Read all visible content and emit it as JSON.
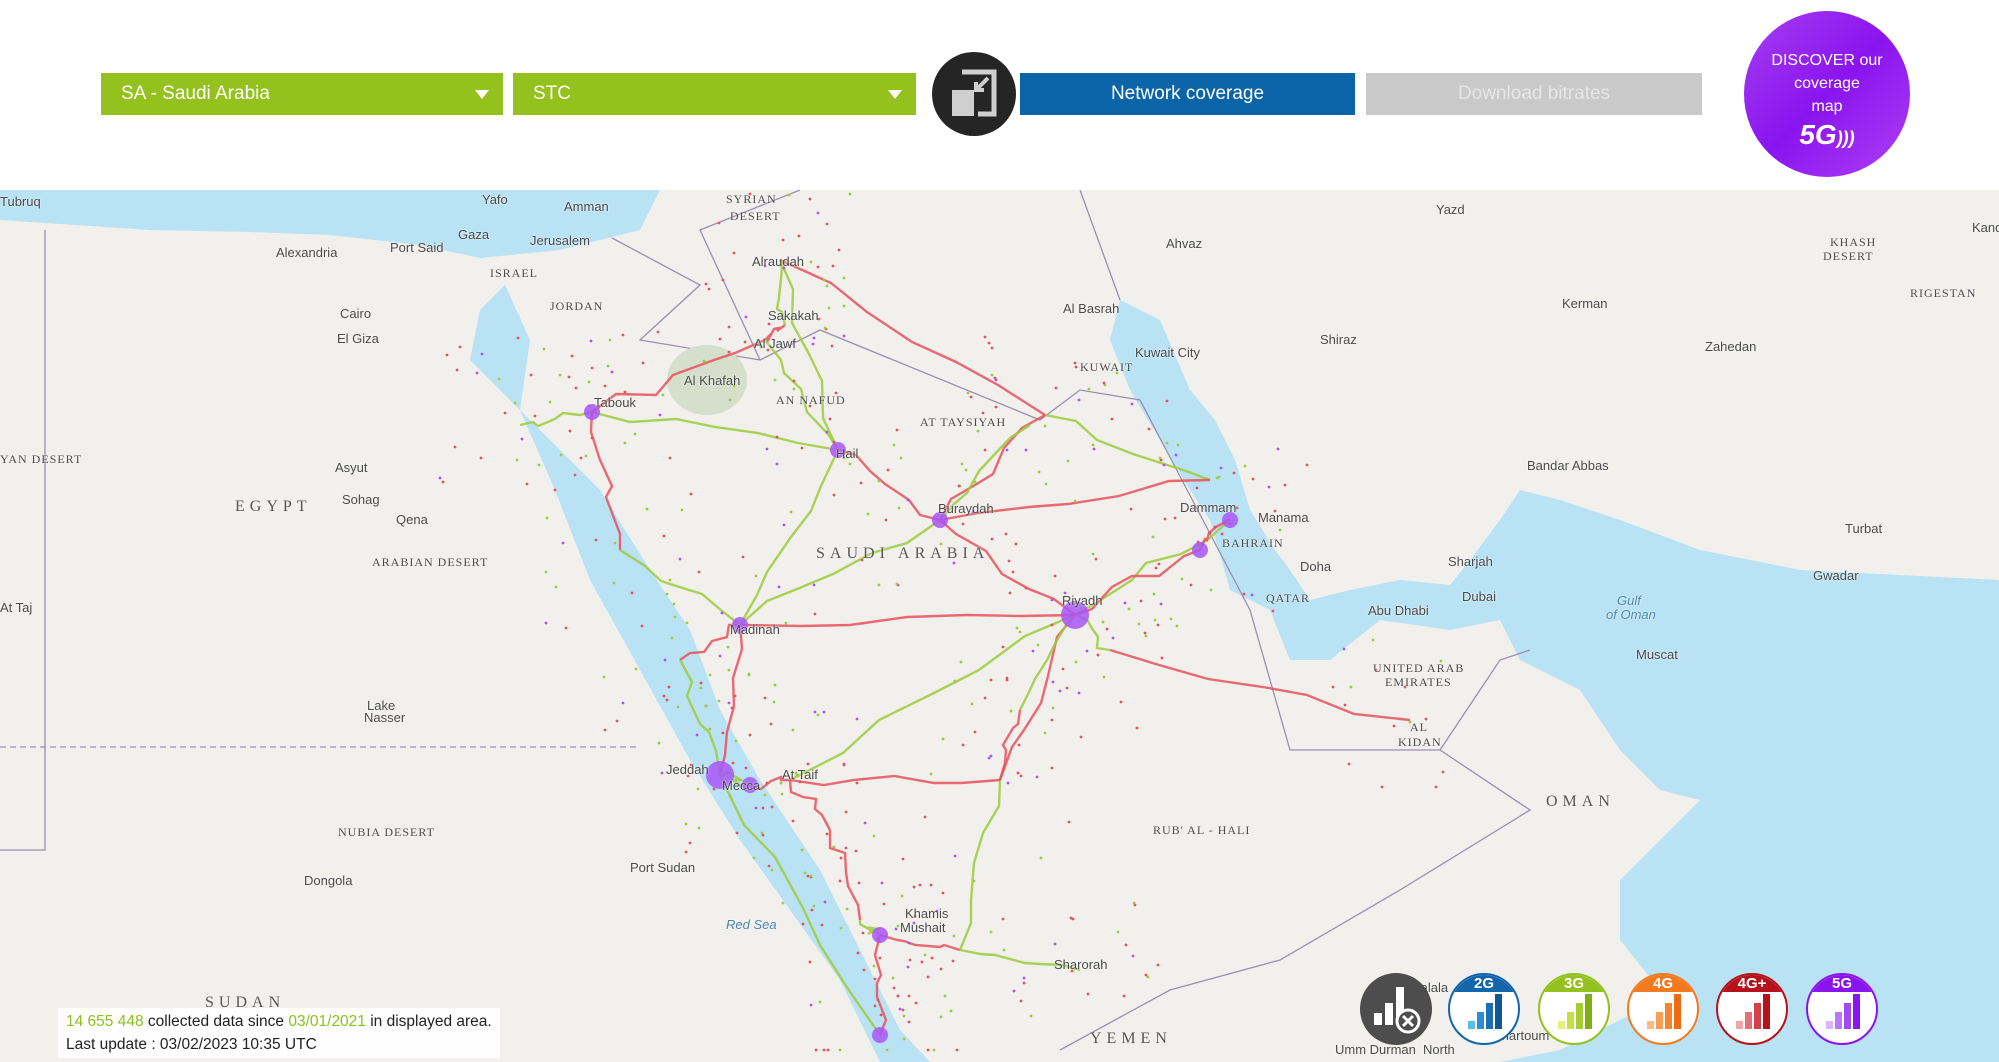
{
  "header": {
    "country_select": {
      "value": "SA - Saudi Arabia"
    },
    "operator_select": {
      "value": "STC"
    },
    "fullscreen_icon": "exit-fullscreen-icon",
    "network_coverage_label": "Network coverage",
    "download_bitrates_label": "Download bitrates",
    "discover": {
      "line1": "DISCOVER our",
      "line2": "coverage",
      "line3": "map",
      "badge": "5G"
    }
  },
  "colors": {
    "green": "#95c11f",
    "blue": "#0b64a8",
    "gray": "#c9c9c9",
    "purple": "#8a14ef",
    "road_2g": "#1a6fb5",
    "road_3g": "#9ccb3b",
    "road_4g_plus": "#e9505b",
    "road_5g": "#a855f7",
    "sea": "#b9e2f5"
  },
  "map": {
    "labels": [
      "Tubruq",
      "Yafo",
      "Amman",
      "SYRIAN",
      "DESERT",
      "Gaza",
      "Jerusalem",
      "Port Said",
      "Alexandria",
      "ISRAEL",
      "JORDAN",
      "Alraudah",
      "Sakakah",
      "Al Jawf",
      "Cairo",
      "El Giza",
      "Al Khafah",
      "AN NAFUD",
      "Tabouk",
      "AT TAYSIYAH",
      "Hail",
      "Ahvaz",
      "Al Basrah",
      "Kuwait City",
      "KUWAIT",
      "Shiraz",
      "Kerman",
      "Yazd",
      "Zahedan",
      "RIGESTAN",
      "KHASH",
      "DESERT",
      "Bandar Abbas",
      "Turbat",
      "Gwadar",
      "EGYPT",
      "Asyut",
      "Sohag",
      "Qena",
      "YAN DESERT",
      "At Taj",
      "Buraydah",
      "SAUDI ARABIA",
      "Dammam",
      "Manama",
      "BAHRAIN",
      "Doha",
      "QATAR",
      "Riyadh",
      "Sharjah",
      "Dubai",
      "Abu Dhabi",
      "Muscat",
      "UNITED ARAB",
      "EMIRATES",
      "AL",
      "KIDAN",
      "Madinah",
      "Gulf",
      "of Oman",
      "OMAN",
      "RUB' AL - HALI",
      "NUBIA DESERT",
      "Jeddah",
      "Mecca",
      "At Taif",
      "Port Sudan",
      "Dongola",
      "Red Sea",
      "Khamis",
      "Mushait",
      "Sharorah",
      "SUDAN",
      "YEMEN",
      "Salala",
      "Lake",
      "Nasser",
      "ARABIAN DESERT",
      "Khartoum",
      "Umm Durman",
      "North",
      "Kand"
    ]
  },
  "info": {
    "count": "14 655 448",
    "text1": " collected data since ",
    "since_date": "03/01/2021",
    "text2": " in displayed area.",
    "last_update": "Last update : 03/02/2023 10:35 UTC"
  },
  "legend": [
    {
      "label": "",
      "icon": "no-signal-icon",
      "color": "#4d4d4d"
    },
    {
      "label": "2G",
      "color": "#1466ab",
      "bars": [
        "#58bde8",
        "#2c8ed0",
        "#1a6fb5",
        "#0f5796"
      ]
    },
    {
      "label": "3G",
      "color": "#95c11f",
      "bars": [
        "#e4f07a",
        "#c3e04a",
        "#a5cd32",
        "#7eaf14"
      ]
    },
    {
      "label": "4G",
      "color": "#f47a20",
      "bars": [
        "#fdb98a",
        "#fb9c57",
        "#f6822f",
        "#ef6a10"
      ]
    },
    {
      "label": "4G+",
      "color": "#b5121b",
      "bars": [
        "#f0a5aa",
        "#e57078",
        "#d43f4a",
        "#b5121b"
      ]
    },
    {
      "label": "5G",
      "color": "#8a14ef",
      "bars": [
        "#dcb5fb",
        "#b978f7",
        "#a04af3",
        "#8a14ef"
      ]
    }
  ]
}
